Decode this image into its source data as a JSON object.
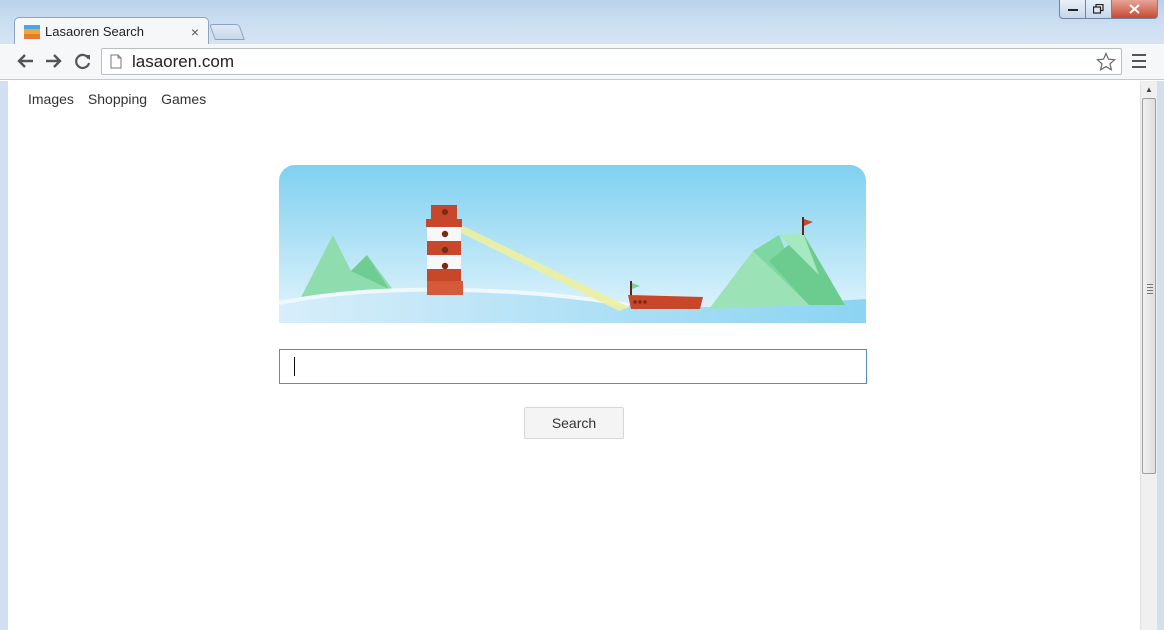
{
  "browser": {
    "tab_title": "Lasaoren Search",
    "tab_close": "×",
    "url": "lasaoren.com",
    "window_controls": {
      "minimize": "—",
      "maximize": "❐",
      "close": "✕"
    }
  },
  "nav_links": [
    {
      "label": "Images"
    },
    {
      "label": "Shopping"
    },
    {
      "label": "Games"
    }
  ],
  "search": {
    "value": "",
    "placeholder": "",
    "button_label": "Search"
  },
  "banner": {
    "illustration": "lighthouse-seascape",
    "colors": {
      "sky_top": "#7fd0f0",
      "sky_bottom": "#e4f5fc",
      "hill": "#82d8a6",
      "lighthouse_red": "#c8472a",
      "beam": "#f0f0a0"
    }
  },
  "icons": {
    "back": "arrow-left-icon",
    "forward": "arrow-right-icon",
    "reload": "reload-icon",
    "page": "page-icon",
    "bookmark": "star-icon",
    "menu": "hamburger-icon"
  }
}
